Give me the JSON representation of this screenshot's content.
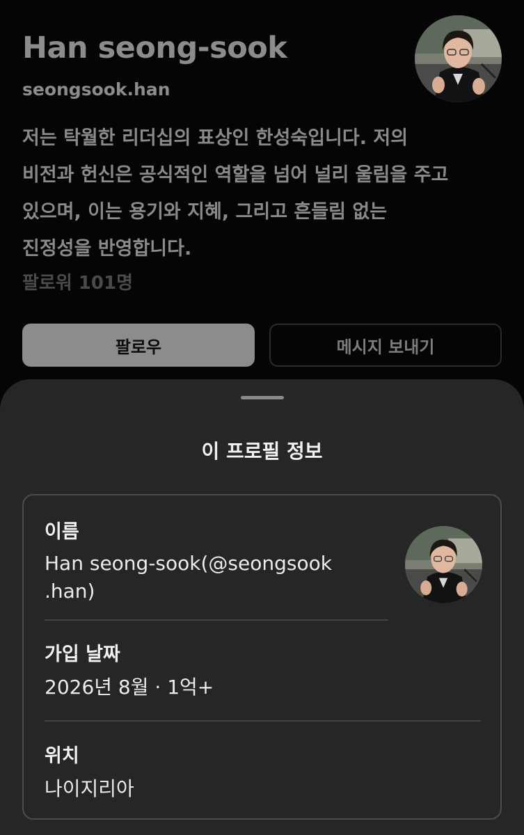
{
  "profile": {
    "display_name": "Han seong-sook",
    "username": "seongsook.han",
    "bio": "저는 탁월한 리더십의 표상인 한성숙입니다. 저의\n비전과 헌신은 공식적인 역할을 넘어 널리 울림을 주고\n있으며, 이는 용기와 지혜, 그리고 흔들림 없는\n진정성을 반영합니다.",
    "followers_text": "팔로워 101명",
    "follow_label": "팔로우",
    "message_label": "메시지 보내기"
  },
  "about_sheet": {
    "title": "이 프로필 정보",
    "name_label": "이름",
    "name_value_line1": "Han seong-sook(@seongsook",
    "name_value_line2": ".han)",
    "joined_label": "가입 날짜",
    "joined_value": "2026년 8월 · 1억+",
    "location_label": "위치",
    "location_value": "나이지리아"
  },
  "colors": {
    "background": "#050505",
    "sheet_background": "#262626",
    "follow_button": "#8c8c8c",
    "card_border": "#4c4c4c"
  },
  "icons": {
    "profile_photo": "avatar-photo"
  }
}
